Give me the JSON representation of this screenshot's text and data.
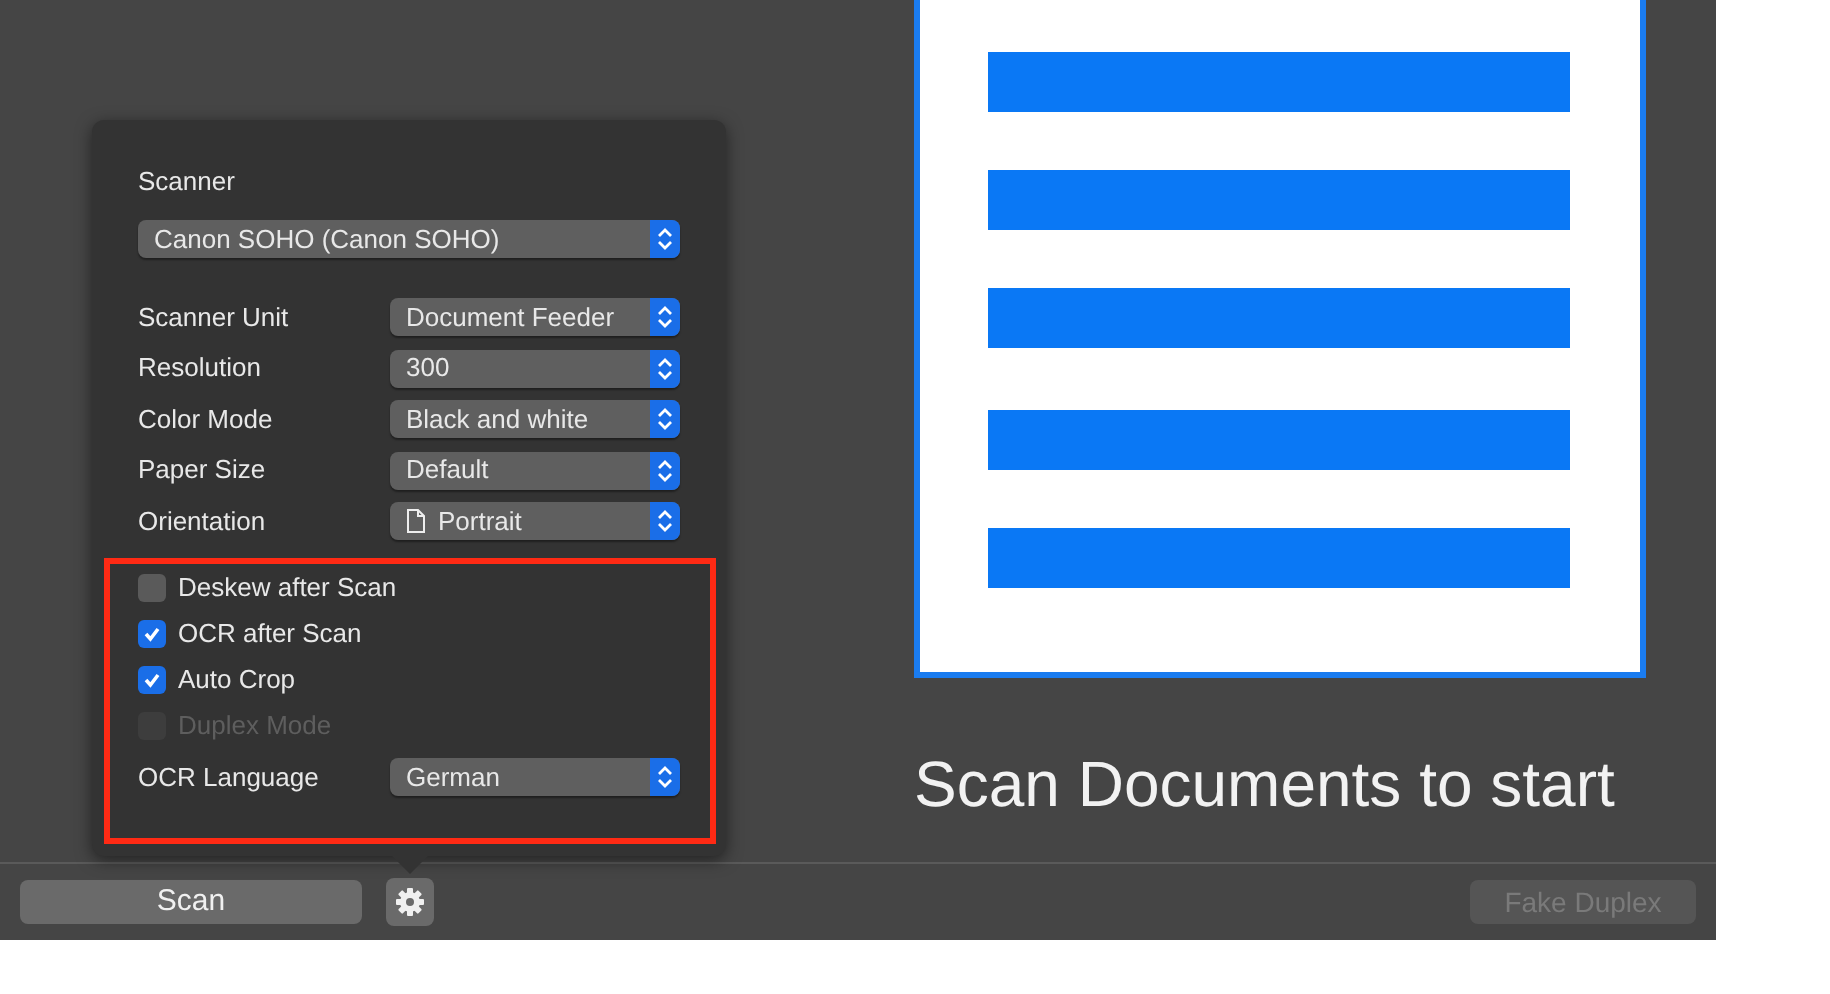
{
  "scanner": {
    "label": "Scanner",
    "value": "Canon SOHO (Canon SOHO)"
  },
  "settings": [
    {
      "label": "Scanner Unit",
      "value": "Document Feeder",
      "kind": "plain"
    },
    {
      "label": "Resolution",
      "value": "300",
      "kind": "plain"
    },
    {
      "label": "Color Mode",
      "value": "Black and white",
      "kind": "plain"
    },
    {
      "label": "Paper Size",
      "value": "Default",
      "kind": "plain"
    },
    {
      "label": "Orientation",
      "value": "Portrait",
      "kind": "page"
    }
  ],
  "options": [
    {
      "label": "Deskew after Scan",
      "checked": false,
      "disabled": false
    },
    {
      "label": "OCR after Scan",
      "checked": true,
      "disabled": false
    },
    {
      "label": "Auto Crop",
      "checked": true,
      "disabled": false
    },
    {
      "label": "Duplex Mode",
      "checked": false,
      "disabled": true
    }
  ],
  "ocr_language": {
    "label": "OCR Language",
    "value": "German"
  },
  "preview_message": "Scan Documents to start",
  "scan_button": {
    "label": "Scan"
  },
  "fake_duplex_button": {
    "label": "Fake Duplex",
    "disabled": true
  }
}
